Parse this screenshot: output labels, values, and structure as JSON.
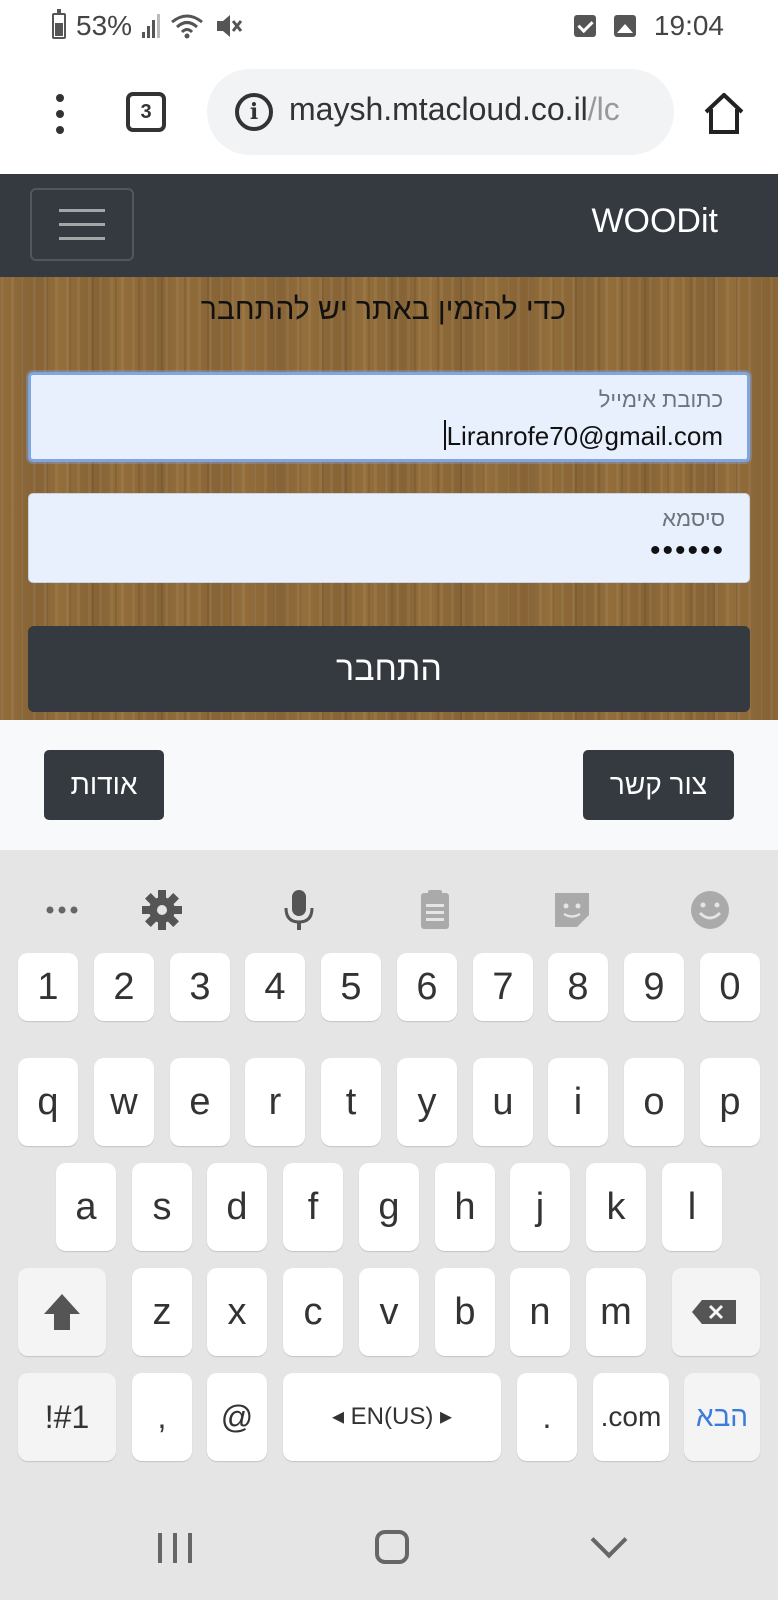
{
  "status_bar": {
    "battery": "53%",
    "time": "19:04"
  },
  "browser": {
    "tab_count": "3",
    "url_host": "maysh.mtacloud.co.il",
    "url_path": "/lc"
  },
  "navbar": {
    "brand": "WOODit"
  },
  "login": {
    "notice": "כדי להזמין באתר יש להתחבר",
    "email_label": "כתובת אימייל",
    "email_value": "Liranrofe70@gmail.com",
    "password_label": "סיסמא",
    "password_value": "••••••",
    "submit_label": "התחבר"
  },
  "footer": {
    "contact_label": "צור קשר",
    "about_label": "אודות"
  },
  "keyboard": {
    "row_numbers": [
      "1",
      "2",
      "3",
      "4",
      "5",
      "6",
      "7",
      "8",
      "9",
      "0"
    ],
    "row_q": [
      "q",
      "w",
      "e",
      "r",
      "t",
      "y",
      "u",
      "i",
      "o",
      "p"
    ],
    "row_a": [
      "a",
      "s",
      "d",
      "f",
      "g",
      "h",
      "j",
      "k",
      "l"
    ],
    "row_z": [
      "z",
      "x",
      "c",
      "v",
      "b",
      "n",
      "m"
    ],
    "symbols_key": "!#1",
    "comma_key": ",",
    "at_key": "@",
    "language_key": "◂ EN(US) ▸",
    "period_key": ".",
    "dotcom_key": ".com",
    "go_key": "הבא"
  }
}
